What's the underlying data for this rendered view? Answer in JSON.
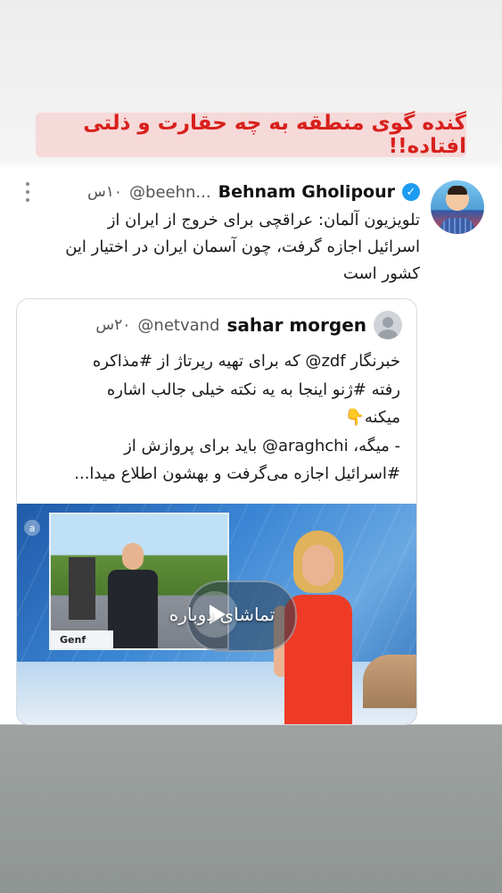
{
  "story_caption": "گنده گوی منطقه به چه حقارت و ذلتی افتاده!!",
  "tweet": {
    "author_name": "Behnam Gholipour",
    "author_handle": "@beehn...",
    "time": "۱۰س",
    "verified": true,
    "text_lines": [
      "تلویزیون آلمان: عراقچی برای خروج از ایران از",
      "اسرائیل اجازه گرفت، چون آسمان ایران در اختیار این",
      "کشور است"
    ]
  },
  "quoted_tweet": {
    "author_name": "sahar morgen",
    "author_handle": "@netvand",
    "time": "۲۰س",
    "text_lines": [
      "خبرنگار zdf@ که برای تهیه ریرتاژ از #مذاکره",
      "رفته #ژنو اینجا به یه نکته خیلی جالب اشاره",
      "میکنه👇",
      "- میگه، araghchi@ باید برای پروازش از",
      "#اسرائیل اجازه می‌گرفت و بهشون اطلاع میدا..."
    ],
    "media": {
      "inset_label": "Genf",
      "replay_label": "تماشای دوباره"
    }
  },
  "colors": {
    "caption_text": "#d8201c",
    "caption_bg": "#f6d9d9",
    "verified": "#1d9bf0"
  }
}
